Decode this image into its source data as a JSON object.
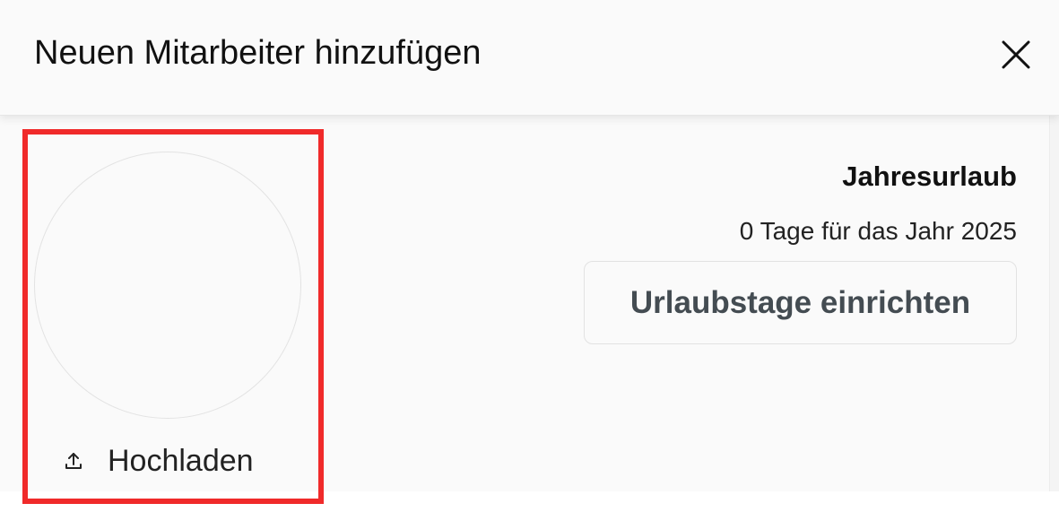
{
  "dialog": {
    "title": "Neuen Mitarbeiter hinzufügen",
    "close_icon": "close-icon"
  },
  "avatar": {
    "upload_label": "Hochladen",
    "upload_icon": "upload-icon"
  },
  "vacation": {
    "title": "Jahresurlaub",
    "info": "0 Tage für das Jahr 2025",
    "setup_button": "Urlaubstage einrichten"
  },
  "colors": {
    "highlight": "#f02a2a",
    "background": "#fafafa",
    "button_text": "#444c52"
  }
}
